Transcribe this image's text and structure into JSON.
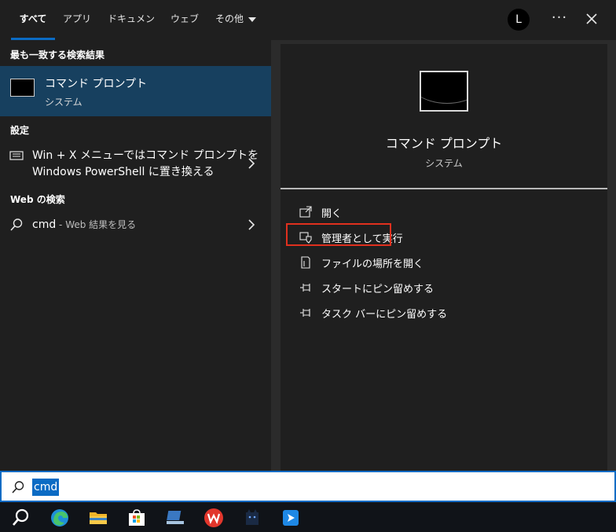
{
  "tabs": [
    {
      "label": "すべて"
    },
    {
      "label": "アプリ"
    },
    {
      "label": "ドキュメント"
    },
    {
      "label": "ウェブ"
    },
    {
      "label": "その他"
    }
  ],
  "user_initial": "L",
  "left": {
    "best_match_header": "最も一致する検索結果",
    "best_match": {
      "title": "コマンド プロンプト",
      "subtitle": "システム"
    },
    "settings_header": "設定",
    "settings_item": {
      "line1": "Win + X メニューではコマンド プロンプトを",
      "line2": "Windows PowerShell に置き換える"
    },
    "web_header": "Web の検索",
    "web_item": {
      "query": "cmd",
      "suffix": " - Web 結果を見る"
    }
  },
  "preview": {
    "title": "コマンド プロンプト",
    "subtitle": "システム",
    "actions": [
      {
        "label": "開く",
        "icon": "open-icon"
      },
      {
        "label": "管理者として実行",
        "icon": "shield-icon"
      },
      {
        "label": "ファイルの場所を開く",
        "icon": "file-location-icon"
      },
      {
        "label": "スタートにピン留めする",
        "icon": "pin-icon"
      },
      {
        "label": "タスク バーにピン留めする",
        "icon": "pin-icon"
      }
    ]
  },
  "search": {
    "query": "cmd"
  },
  "taskbar": {
    "items": [
      "search-icon",
      "edge-icon",
      "file-explorer-icon",
      "store-icon",
      "app-icon",
      "wps-icon",
      "cat-app-icon",
      "arrow-app-icon"
    ]
  },
  "colors": {
    "accent": "#0b6bc4",
    "selection": "#17405f",
    "highlight_box": "#e0301e"
  }
}
